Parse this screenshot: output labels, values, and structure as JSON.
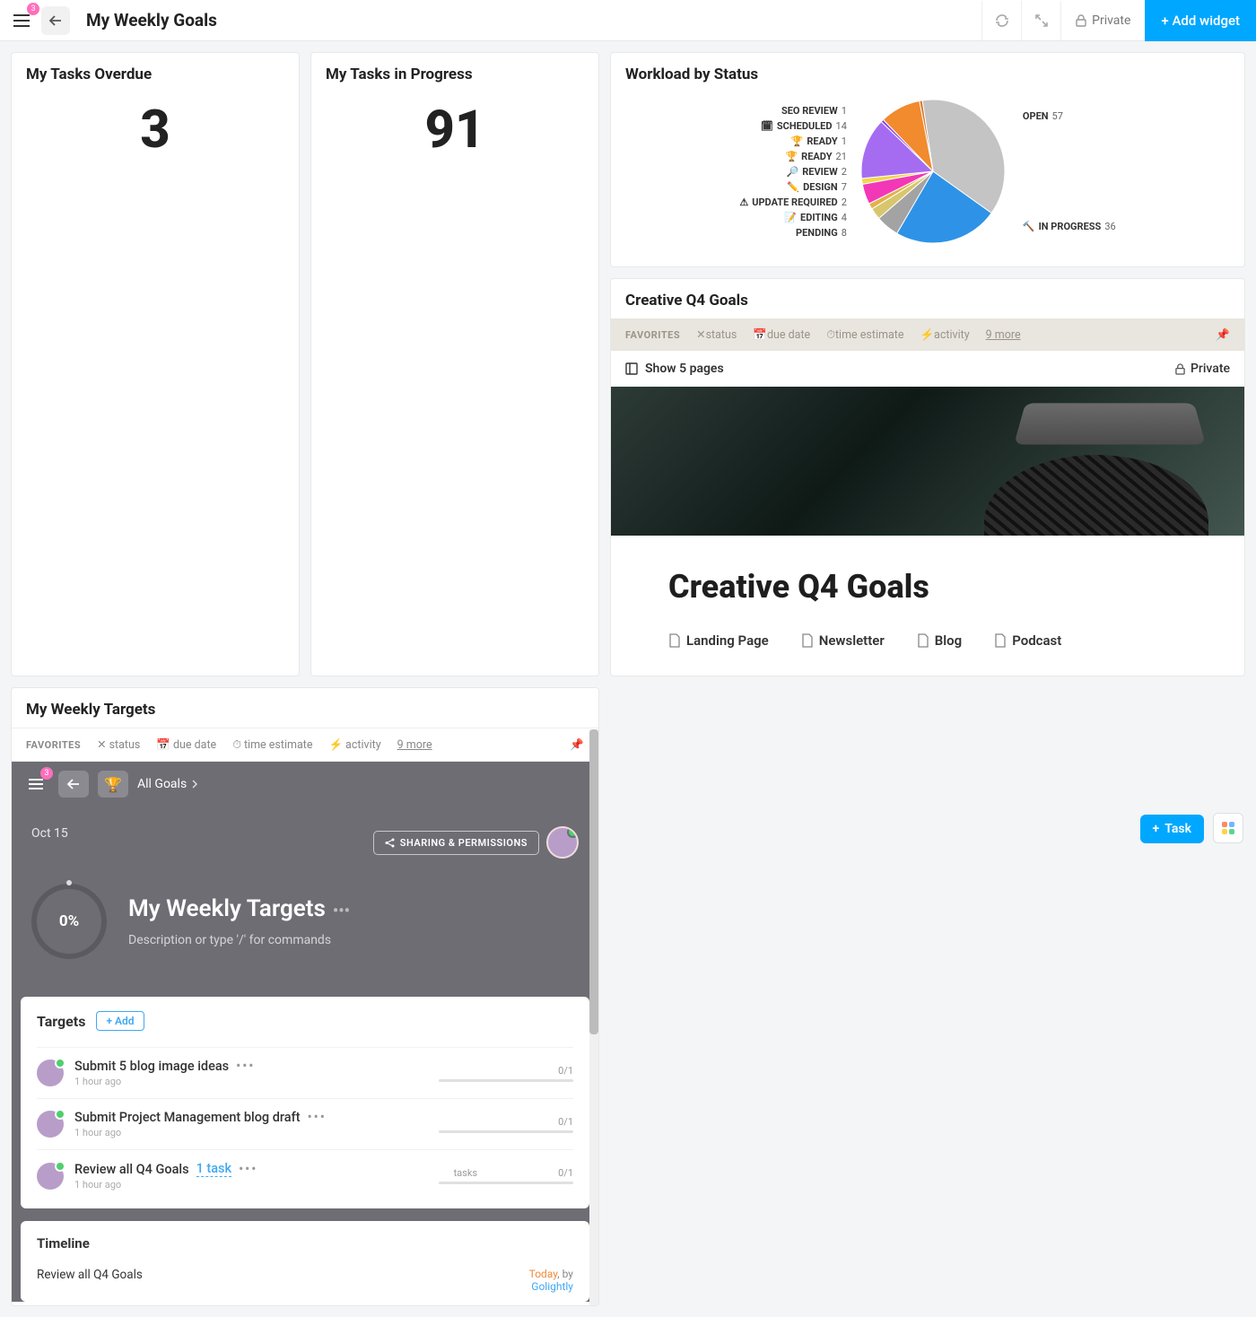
{
  "header": {
    "menu_badge": "3",
    "title": "My Weekly Goals",
    "private_label": "Private",
    "add_widget_label": "+ Add widget"
  },
  "cards": {
    "overdue_title": "My Tasks Overdue",
    "overdue_value": "3",
    "inprogress_title": "My Tasks in Progress",
    "inprogress_value": "91"
  },
  "weekly": {
    "title": "My Weekly Targets",
    "filters": {
      "favorites": "FAVORITES",
      "status": "status",
      "due_date": "due date",
      "time_estimate": "time estimate",
      "activity": "activity",
      "more": "9 more"
    },
    "panel": {
      "menu_badge": "3",
      "all_goals": "All Goals",
      "date": "Oct 15",
      "share_label": "SHARING & PERMISSIONS",
      "percent": "0%",
      "big_title": "My Weekly Targets",
      "description": "Description or type '/' for commands"
    },
    "targets": {
      "title": "Targets",
      "add_label": "+ Add",
      "items": [
        {
          "name": "Submit 5 blog image ideas",
          "time": "1 hour ago",
          "frac": "0/1",
          "label": ""
        },
        {
          "name": "Submit Project Management blog draft",
          "time": "1 hour ago",
          "frac": "0/1",
          "label": ""
        },
        {
          "name": "Review all Q4 Goals",
          "link": "1 task",
          "time": "1 hour ago",
          "frac": "0/1",
          "label": "tasks"
        }
      ]
    },
    "timeline": {
      "title": "Timeline",
      "item": "Review all Q4 Goals",
      "today": "Today",
      "sep": ", by",
      "who": "Golightly"
    }
  },
  "workload": {
    "title": "Workload by Status"
  },
  "chart_data": {
    "type": "pie",
    "title": "Workload by Status",
    "series": [
      {
        "name": "OPEN",
        "value": 57,
        "color": "#c4c4c4"
      },
      {
        "name": "IN PROGRESS",
        "value": 36,
        "color": "#2e93e6"
      },
      {
        "name": "PENDING",
        "value": 8,
        "color": "#a3a3a3"
      },
      {
        "name": "EDITING",
        "value": 4,
        "color": "#d8c66e"
      },
      {
        "name": "UPDATE REQUIRED",
        "value": 2,
        "color": "#e2b24a"
      },
      {
        "name": "DESIGN",
        "value": 7,
        "color": "#f238b7"
      },
      {
        "name": "REVIEW",
        "value": 2,
        "color": "#f2d74a"
      },
      {
        "name": "READY",
        "value": 21,
        "color": "#a56cf2"
      },
      {
        "name": "READY",
        "value": 1,
        "color": "#8a3fe6"
      },
      {
        "name": "SCHEDULED",
        "value": 14,
        "color": "#f28a2e"
      },
      {
        "name": "SEO REVIEW",
        "value": 1,
        "color": "#d37a2e"
      }
    ],
    "labels_left": [
      {
        "icon": "",
        "name": "SEO REVIEW",
        "value": "1"
      },
      {
        "icon": "🗓",
        "name": "SCHEDULED",
        "value": "14"
      },
      {
        "icon": "🏆",
        "name": "READY",
        "value": "1"
      },
      {
        "icon": "🏆",
        "name": "READY",
        "value": "21"
      },
      {
        "icon": "🔎",
        "name": "REVIEW",
        "value": "2"
      },
      {
        "icon": "✏️",
        "name": "DESIGN",
        "value": "7"
      },
      {
        "icon": "⚠",
        "name": "UPDATE REQUIRED",
        "value": "2"
      },
      {
        "icon": "📝",
        "name": "EDITING",
        "value": "4"
      },
      {
        "icon": "",
        "name": "PENDING",
        "value": "8"
      }
    ],
    "label_right_top": {
      "name": "OPEN",
      "value": "57"
    },
    "label_right_bottom": {
      "icon": "🔨",
      "name": "IN PROGRESS",
      "value": "36"
    }
  },
  "creative": {
    "title": "Creative Q4 Goals",
    "filters": {
      "favorites": "FAVORITES",
      "status": "status",
      "due_date": "due date",
      "time_estimate": "time estimate",
      "activity": "activity",
      "more": "9 more"
    },
    "show_pages": "Show 5 pages",
    "private": "Private",
    "doc_title": "Creative Q4 Goals",
    "links": [
      {
        "label": "Landing Page"
      },
      {
        "label": "Newsletter"
      },
      {
        "label": "Blog"
      },
      {
        "label": "Podcast"
      }
    ]
  },
  "fab": {
    "task": "Task"
  }
}
